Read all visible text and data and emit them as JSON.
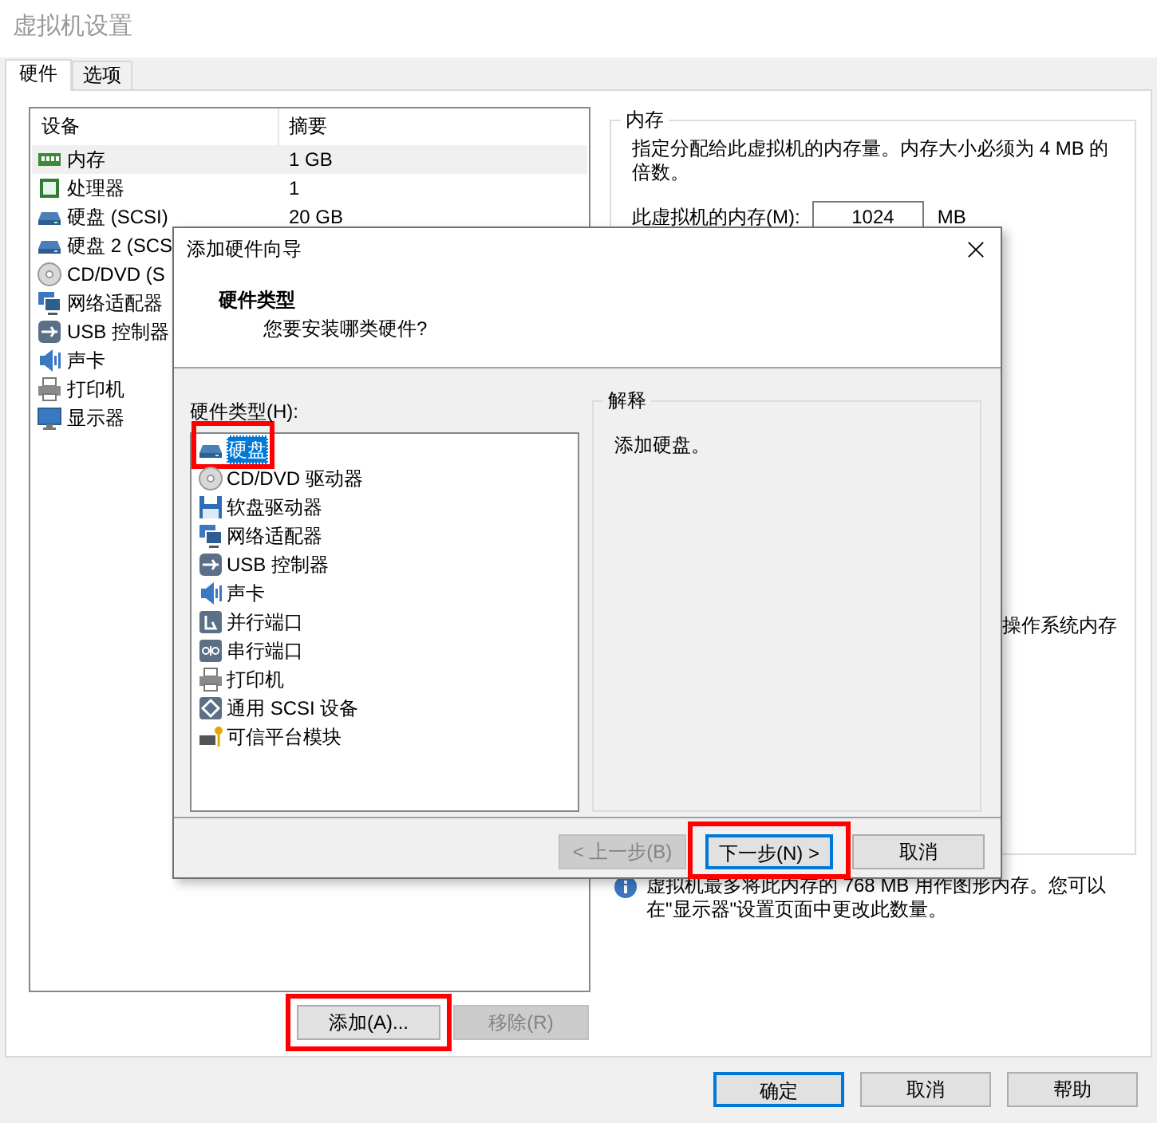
{
  "window": {
    "title": "虚拟机设置"
  },
  "tabs": [
    {
      "label": "硬件",
      "selected": true
    },
    {
      "label": "选项",
      "selected": false
    }
  ],
  "devices": {
    "columns": [
      "设备",
      "摘要"
    ],
    "rows": [
      {
        "kind": "memory",
        "name": "内存",
        "summary": "1 GB",
        "selected": true
      },
      {
        "kind": "cpu",
        "name": "处理器",
        "summary": "1",
        "selected": false
      },
      {
        "kind": "disk",
        "name": "硬盘 (SCSI)",
        "summary": "20 GB",
        "selected": false
      },
      {
        "kind": "disk",
        "name": "硬盘 2 (SCS",
        "selected": false
      },
      {
        "kind": "cd",
        "name": "CD/DVD (S",
        "selected": false
      },
      {
        "kind": "network",
        "name": "网络适配器",
        "selected": false
      },
      {
        "kind": "usb",
        "name": "USB 控制器",
        "selected": false
      },
      {
        "kind": "sound",
        "name": "声卡",
        "selected": false
      },
      {
        "kind": "printer",
        "name": "打印机",
        "selected": false
      },
      {
        "kind": "display",
        "name": "显示器",
        "selected": false
      }
    ]
  },
  "device_buttons": [
    {
      "label": "添加(A)...",
      "disabled": false,
      "highlighted": true
    },
    {
      "label": "移除(R)",
      "disabled": true,
      "highlighted": false
    }
  ],
  "memory_panel": {
    "title": "内存",
    "description": "指定分配给此虚拟机的内存量。内存大小必须为 4 MB 的倍数。",
    "memory_label": "此虚拟机的内存(M):",
    "memory_value": "1024",
    "memory_unit": "MB",
    "partial_text": "操作系统内存"
  },
  "note": "虚拟机最多将此内存的 768 MB 用作图形内存。您可以在\"显示器\"设置页面中更改此数量。",
  "dialog": {
    "title": "添加硬件向导",
    "heading": "硬件类型",
    "subheading": "您要安装哪类硬件?",
    "list_label": "硬件类型(H):",
    "hardware_types": [
      {
        "kind": "disk",
        "label": "硬盘",
        "selected": true,
        "highlighted": true
      },
      {
        "kind": "cd",
        "label": "CD/DVD 驱动器",
        "selected": false,
        "highlighted": false
      },
      {
        "kind": "floppy",
        "label": "软盘驱动器",
        "selected": false,
        "highlighted": false
      },
      {
        "kind": "network",
        "label": "网络适配器",
        "selected": false,
        "highlighted": false
      },
      {
        "kind": "usb",
        "label": "USB 控制器",
        "selected": false,
        "highlighted": false
      },
      {
        "kind": "sound",
        "label": "声卡",
        "selected": false,
        "highlighted": false
      },
      {
        "kind": "parallel",
        "label": "并行端口",
        "selected": false,
        "highlighted": false
      },
      {
        "kind": "serial",
        "label": "串行端口",
        "selected": false,
        "highlighted": false
      },
      {
        "kind": "printer",
        "label": "打印机",
        "selected": false,
        "highlighted": false
      },
      {
        "kind": "scsi",
        "label": "通用 SCSI 设备",
        "selected": false,
        "highlighted": false
      },
      {
        "kind": "tpm",
        "label": "可信平台模块",
        "selected": false,
        "highlighted": false
      }
    ],
    "explanation_title": "解释",
    "explanation": "添加硬盘。",
    "buttons": [
      {
        "label": "< 上一步(B)",
        "disabled": true,
        "focused": false,
        "highlighted": false
      },
      {
        "label": "下一步(N) >",
        "disabled": false,
        "focused": true,
        "highlighted": true
      },
      {
        "label": "取消",
        "disabled": false,
        "focused": false,
        "highlighted": false
      }
    ]
  },
  "buttons": [
    {
      "label": "确定",
      "focused": true
    },
    {
      "label": "取消",
      "focused": false
    },
    {
      "label": "帮助",
      "focused": false
    }
  ]
}
